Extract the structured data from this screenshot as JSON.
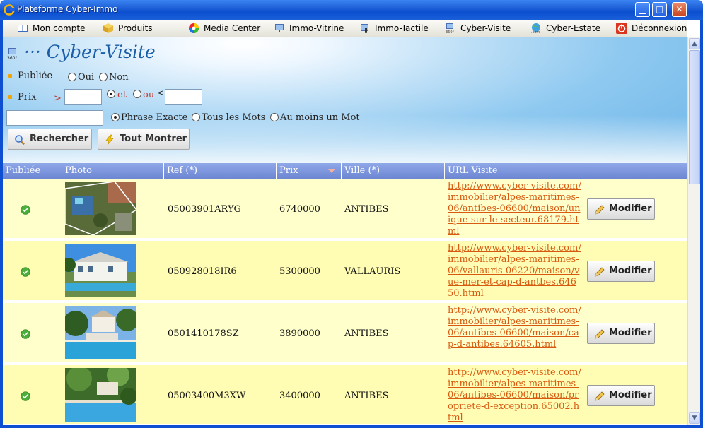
{
  "window": {
    "title": "Plateforme Cyber-Immo",
    "min": "▁",
    "max": "□",
    "close": "✕"
  },
  "menu": [
    {
      "label": "Mon compte",
      "icon": "book-icon"
    },
    {
      "label": "Produits",
      "icon": "box-icon"
    },
    {
      "label": "Media Center",
      "icon": "color-wheel-icon"
    },
    {
      "label": "Immo-Vitrine",
      "icon": "monitor-icon"
    },
    {
      "label": "Immo-Tactile",
      "icon": "touch-screen-icon"
    },
    {
      "label": "Cyber-Visite",
      "icon": "360-camera-icon"
    },
    {
      "label": "Cyber-Estate",
      "icon": "globe-com-icon"
    },
    {
      "label": "Déconnexion",
      "icon": "power-icon"
    }
  ],
  "page": {
    "title": "··· Cyber-Visite"
  },
  "filters": {
    "publiee_label": "Publiée",
    "oui": "Oui",
    "non": "Non",
    "prix_label": "Prix",
    "gt": ">",
    "lt": "<",
    "et": "et",
    "ou": "ou",
    "prix_min": "",
    "prix_max": "",
    "search_text": "",
    "phrase_exacte": "Phrase Exacte",
    "tous_mots": "Tous les Mots",
    "au_moins": "Au moins un Mot",
    "rechercher": "Rechercher",
    "tout_montrer": "Tout Montrer"
  },
  "table": {
    "headers": [
      "Publiée",
      "Photo",
      "Ref (*)",
      "Prix",
      "Ville (*)",
      "URL Visite",
      ""
    ],
    "rows": [
      {
        "ref": "05003901ARYG",
        "prix": "6740000",
        "ville": "ANTIBES",
        "url": "http://www.cyber-visite.com/immobilier/alpes-maritimes-06/antibes-06600/maison/unique-sur-le-secteur.68179.html",
        "action": "Modifier"
      },
      {
        "ref": "050928018IR6",
        "prix": "5300000",
        "ville": "VALLAURIS",
        "url": "http://www.cyber-visite.com/immobilier/alpes-maritimes-06/vallauris-06220/maison/vue-mer-et-cap-d-antbes.64650.html",
        "action": "Modifier"
      },
      {
        "ref": "0501410178SZ",
        "prix": "3890000",
        "ville": "ANTIBES",
        "url": "http://www.cyber-visite.com/immobilier/alpes-maritimes-06/antibes-06600/maison/cap-d-antibes.64605.html",
        "action": "Modifier"
      },
      {
        "ref": "05003400M3XW",
        "prix": "3400000",
        "ville": "ANTIBES",
        "url": "http://www.cyber-visite.com/immobilier/alpes-maritimes-06/antibes-06600/maison/propriete-d-exception.65002.html",
        "action": "Modifier"
      }
    ]
  },
  "colors": {
    "accent": "#1a5ea8",
    "link": "#d75a10",
    "row_bg": "#ffffcc",
    "header_bg": "#7a93da"
  }
}
